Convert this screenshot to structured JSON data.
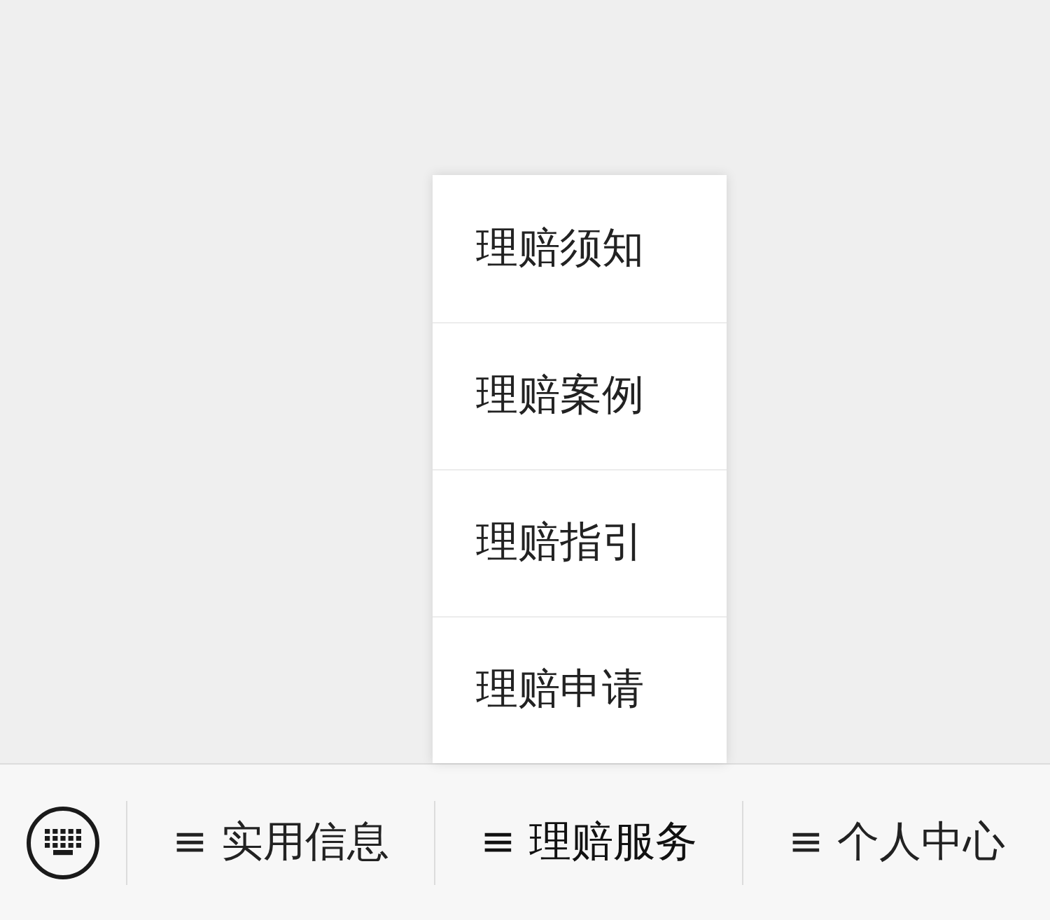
{
  "menu_bar": {
    "menus": [
      {
        "label": "≡ 实用信息",
        "expanded": false
      },
      {
        "label": "≡ 理赔服务",
        "expanded": true,
        "items": [
          "理赔须知",
          "理赔案例",
          "理赔指引",
          "理赔申请"
        ]
      },
      {
        "label": "≡ 个人中心",
        "expanded": false
      }
    ]
  }
}
